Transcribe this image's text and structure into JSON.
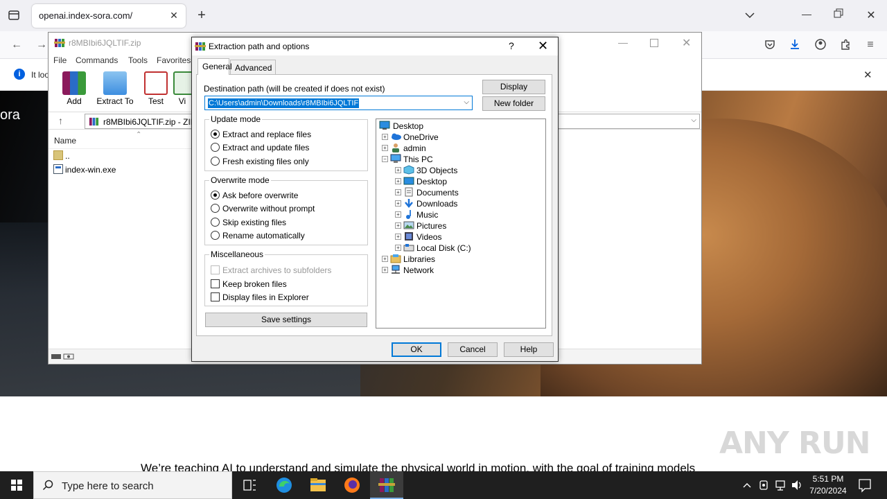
{
  "browser": {
    "tab_title": "openai.index-sora.com/",
    "notification_text": "It loo"
  },
  "page": {
    "logo_text": "ora",
    "headline": "We’re teaching AI to understand and simulate the physical world in motion, with the goal of training models",
    "watermark": "ANY RUN"
  },
  "winrar": {
    "title": "r8MBIbi6JQLTIF.zip",
    "menu": [
      "File",
      "Commands",
      "Tools",
      "Favorites"
    ],
    "toolbar": [
      "Add",
      "Extract To",
      "Test",
      "Vi"
    ],
    "address": "r8MBIbi6JQLTIF.zip - ZIP",
    "column_name": "Name",
    "files": [
      "..",
      "index-win.exe"
    ]
  },
  "dialog": {
    "title": "Extraction path and options",
    "help_glyph": "?",
    "tabs": [
      "General",
      "Advanced"
    ],
    "dest_label": "Destination path (will be created if does not exist)",
    "dest_value": "C:\\Users\\admin\\Downloads\\r8MBIbi6JQLTIF",
    "display_button": "Display",
    "new_folder_button": "New folder",
    "update_mode": {
      "label": "Update mode",
      "options": [
        "Extract and replace files",
        "Extract and update files",
        "Fresh existing files only"
      ],
      "selected": 0
    },
    "overwrite_mode": {
      "label": "Overwrite mode",
      "options": [
        "Ask before overwrite",
        "Overwrite without prompt",
        "Skip existing files",
        "Rename automatically"
      ],
      "selected": 0
    },
    "misc": {
      "label": "Miscellaneous",
      "options": [
        "Extract archives to subfolders",
        "Keep broken files",
        "Display files in Explorer"
      ]
    },
    "save_settings": "Save settings",
    "tree": [
      "Desktop",
      "OneDrive",
      "admin",
      "This PC",
      "3D Objects",
      "Desktop",
      "Documents",
      "Downloads",
      "Music",
      "Pictures",
      "Videos",
      "Local Disk (C:)",
      "Libraries",
      "Network"
    ],
    "ok": "OK",
    "cancel": "Cancel",
    "help": "Help"
  },
  "taskbar": {
    "search_placeholder": "Type here to search",
    "time": "5:51 PM",
    "date": "7/20/2024"
  }
}
